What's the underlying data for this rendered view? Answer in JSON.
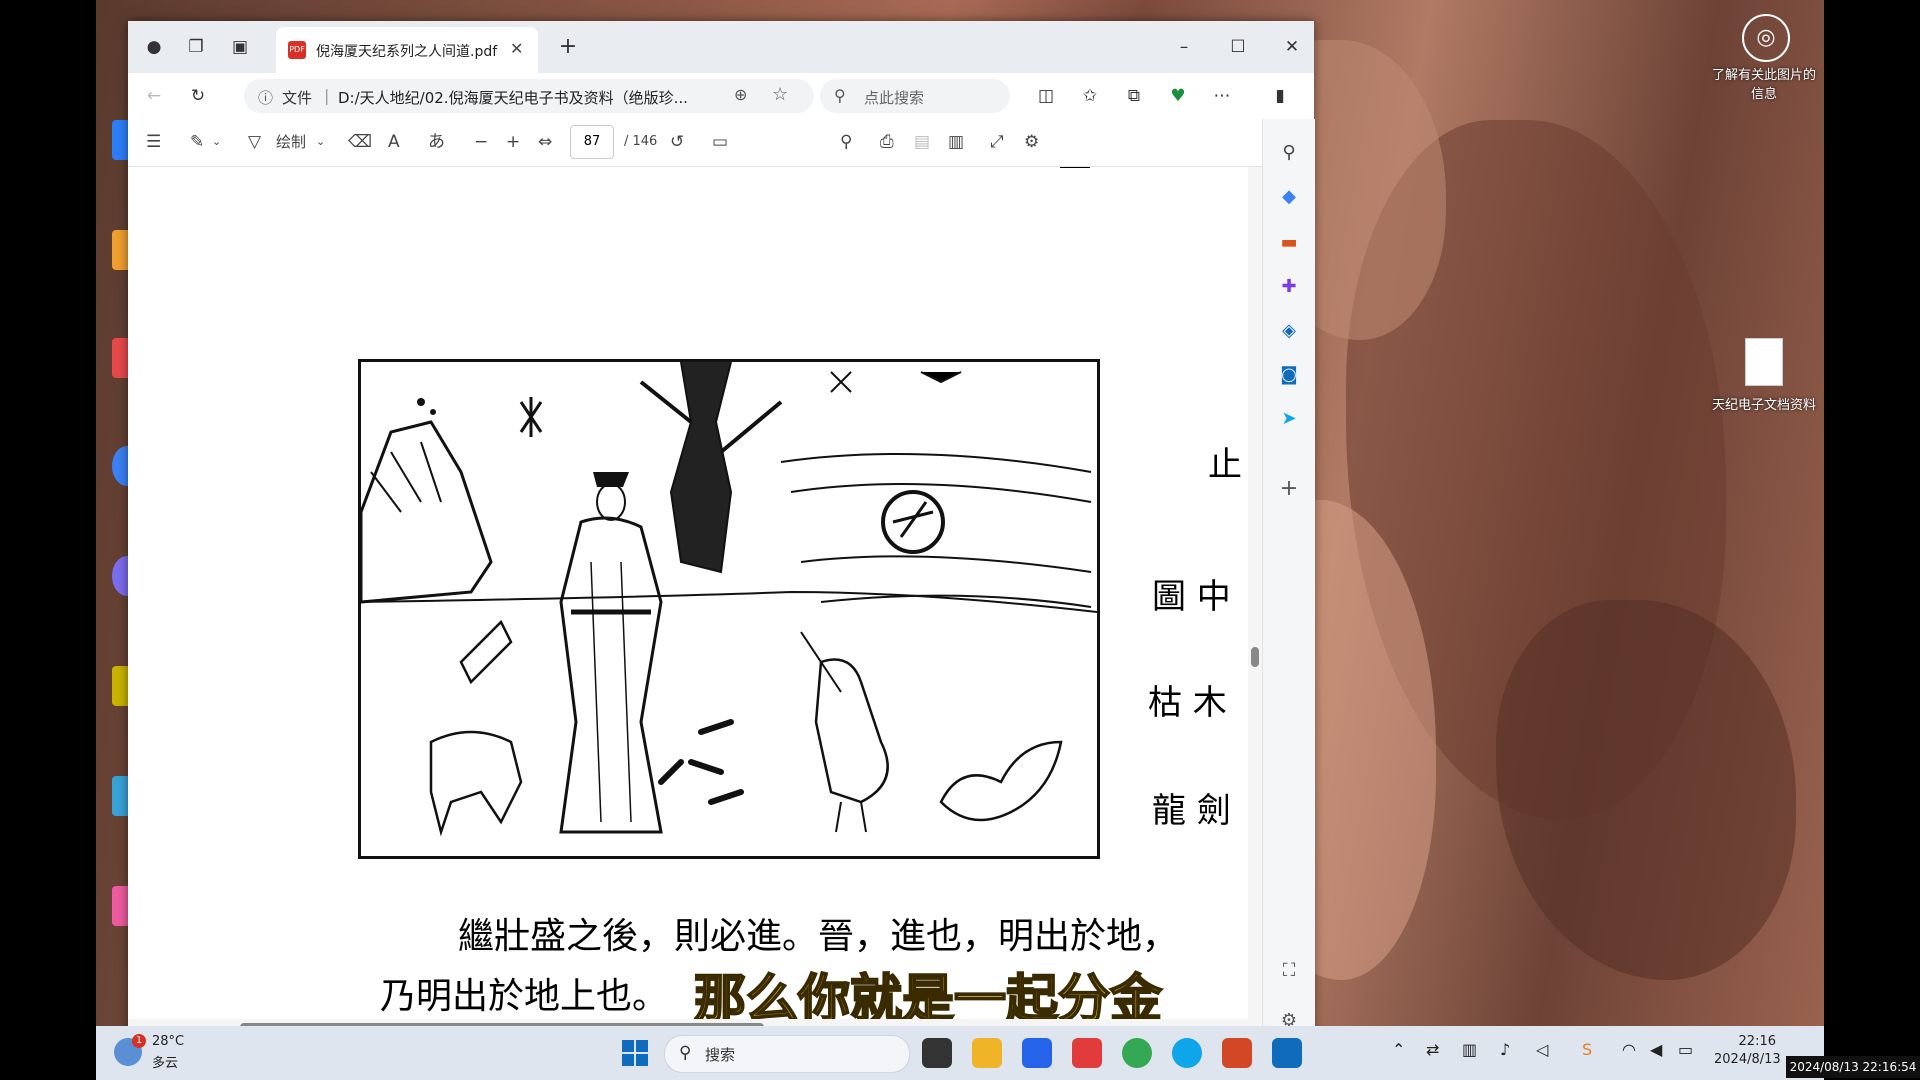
{
  "window": {
    "tab_title": "倪海厦天纪系列之人间道.pdf",
    "minimize": "–",
    "maximize": "☐",
    "close": "✕"
  },
  "address": {
    "info_label": "文件",
    "url": "D:/天人地纪/02.倪海厦天纪电子书及资料（绝版珍...",
    "search_placeholder": "点此搜索"
  },
  "pdf_toolbar": {
    "draw_label": "绘制",
    "page_current": "87",
    "page_total": "/ 146"
  },
  "pdf_content": {
    "right_column_text": [
      "止",
      "圖 中",
      "枯 木",
      "龍 劍"
    ],
    "line1": "繼壯盛之後，則必進。晉，進也，明出於地，",
    "line2": "乃明出於地上也。",
    "subtitle": "那么你就是一起分金"
  },
  "desktop": {
    "photo_info": "了解有关此图片的信息",
    "file_icon_label": "天纪电子文档资料"
  },
  "taskbar": {
    "weather_temp": "28°C",
    "weather_desc": "多云",
    "weather_badge": "1",
    "search_label": "搜索",
    "time": "22:16",
    "date": "2024/8/13",
    "watermark": "2024/08/13 22:16:54"
  },
  "colors": {
    "accent": "#0f6cbd",
    "subtitle_fill": "#f5c518",
    "subtitle_stroke": "#3a2a00"
  }
}
